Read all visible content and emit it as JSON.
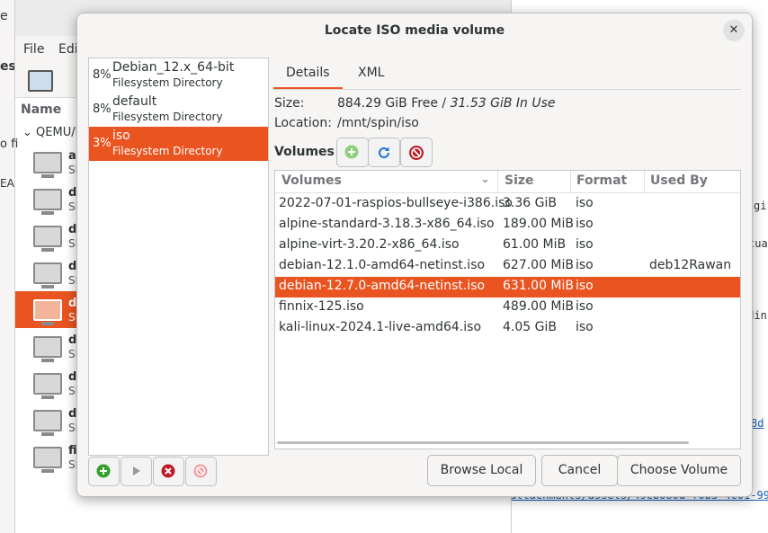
{
  "background": {
    "menu": [
      "File",
      "Edi"
    ],
    "column_name": "Name",
    "group": "QEMU/K",
    "search_frag": "o fi",
    "edge_e": "e",
    "edge_es": "es",
    "edge_ead": "EAD",
    "vms": [
      {
        "n1": "al",
        "n2": "SI"
      },
      {
        "n1": "de",
        "n2": "SI"
      },
      {
        "n1": "de",
        "n2": "SI"
      },
      {
        "n1": "de",
        "n2": "SI"
      },
      {
        "n1": "de",
        "n2": "SI"
      },
      {
        "n1": "de",
        "n2": "SI"
      },
      {
        "n1": "de",
        "n2": "SI"
      },
      {
        "n1": "de",
        "n2": "SI"
      },
      {
        "n1": "fi",
        "n2": "SI"
      }
    ],
    "right_frags": [
      "gi",
      "tua",
      "udin",
      "8d",
      "attachments/assets/49cb080d-f0b5-4c01-99"
    ]
  },
  "dialog": {
    "title": "Locate ISO media volume",
    "close_glyph": "✕",
    "pools": [
      {
        "pct": "8%",
        "name": "Debian_12.x_64-bit",
        "type": "Filesystem Directory"
      },
      {
        "pct": "8%",
        "name": "default",
        "type": "Filesystem Directory"
      },
      {
        "pct": "3%",
        "name": "iso",
        "type": "Filesystem Directory"
      }
    ],
    "tabs": {
      "details": "Details",
      "xml": "XML"
    },
    "size_label": "Size:",
    "size_free": "884.29 GiB Free / ",
    "size_used": "31.53 GiB In Use",
    "location_label": "Location:",
    "location_value": "/mnt/spin/iso",
    "volumes_label": "Volumes",
    "columns": {
      "volumes": "Volumes",
      "size": "Size",
      "format": "Format",
      "used_by": "Used By"
    },
    "rows": [
      {
        "name": "2022-07-01-raspios-bullseye-i386.iso",
        "size": "3.36 GiB",
        "format": "iso",
        "used": ""
      },
      {
        "name": "alpine-standard-3.18.3-x86_64.iso",
        "size": "189.00 MiB",
        "format": "iso",
        "used": ""
      },
      {
        "name": "alpine-virt-3.20.2-x86_64.iso",
        "size": "61.00 MiB",
        "format": "iso",
        "used": ""
      },
      {
        "name": "debian-12.1.0-amd64-netinst.iso",
        "size": "627.00 MiB",
        "format": "iso",
        "used": "deb12Rawan"
      },
      {
        "name": "debian-12.7.0-amd64-netinst.iso",
        "size": "631.00 MiB",
        "format": "iso",
        "used": ""
      },
      {
        "name": "finnix-125.iso",
        "size": "489.00 MiB",
        "format": "iso",
        "used": ""
      },
      {
        "name": "kali-linux-2024.1-live-amd64.iso",
        "size": "4.05 GiB",
        "format": "iso",
        "used": ""
      }
    ],
    "buttons": {
      "browse": "Browse Local",
      "cancel": "Cancel",
      "choose": "Choose Volume"
    }
  },
  "colors": {
    "accent": "#e95420",
    "add": "#33a02c",
    "refresh": "#1c71d8",
    "delete": "#c01c28"
  }
}
